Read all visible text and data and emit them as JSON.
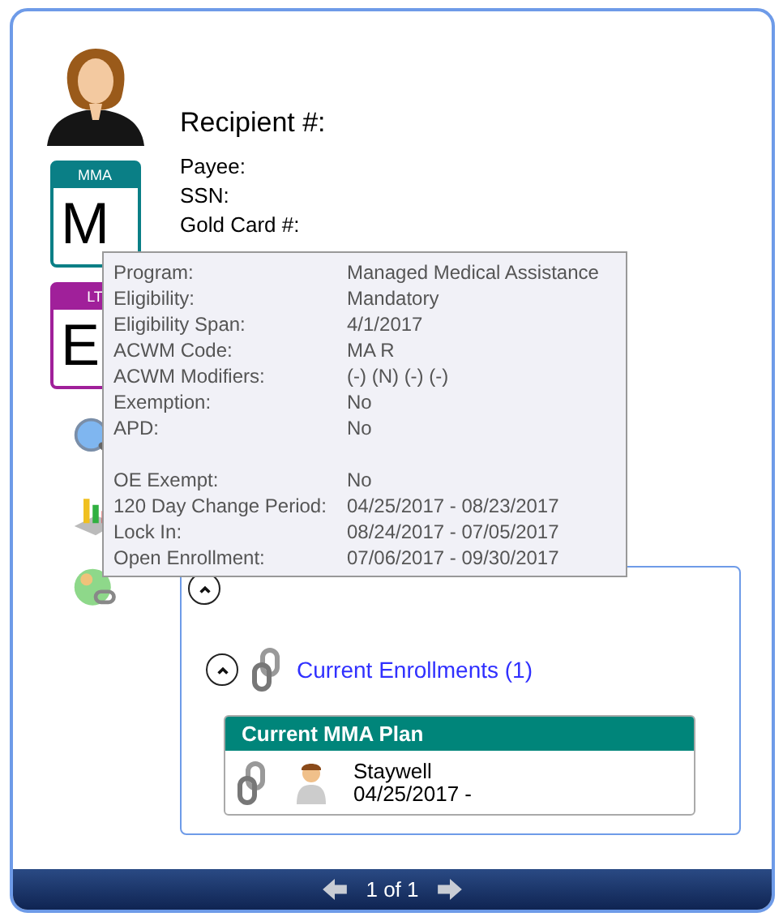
{
  "recipient": {
    "title": "Recipient #:",
    "fields": [
      "Payee:",
      "SSN:",
      "Gold Card #:"
    ]
  },
  "program_cards": [
    {
      "code": "MMA",
      "letter": "M",
      "color": "#0a7f86"
    },
    {
      "code": "LT",
      "letter": "E",
      "color": "#a0209a"
    }
  ],
  "tooltip": {
    "groups": [
      [
        {
          "label": "Program:",
          "value": "Managed Medical Assistance"
        },
        {
          "label": "Eligibility:",
          "value": "Mandatory"
        },
        {
          "label": "Eligibility Span:",
          "value": "4/1/2017"
        },
        {
          "label": "ACWM Code:",
          "value": "MA R"
        },
        {
          "label": "ACWM Modifiers:",
          "value": "(-) (N) (-) (-)"
        },
        {
          "label": "Exemption:",
          "value": "No"
        },
        {
          "label": "APD:",
          "value": "No"
        }
      ],
      [
        {
          "label": "OE Exempt:",
          "value": "No"
        },
        {
          "label": "120 Day Change Period:",
          "value": "04/25/2017 - 08/23/2017"
        },
        {
          "label": "Lock In:",
          "value": "08/24/2017 - 07/05/2017"
        },
        {
          "label": "Open Enrollment:",
          "value": "07/06/2017 - 09/30/2017"
        }
      ]
    ]
  },
  "enrollments": {
    "expanded": true,
    "section": {
      "expanded": true,
      "label": "Current Enrollments (1)"
    },
    "plan": {
      "title": "Current MMA Plan",
      "name": "Staywell",
      "dates": "04/25/2017 -"
    }
  },
  "pager": {
    "label": "1 of 1"
  }
}
